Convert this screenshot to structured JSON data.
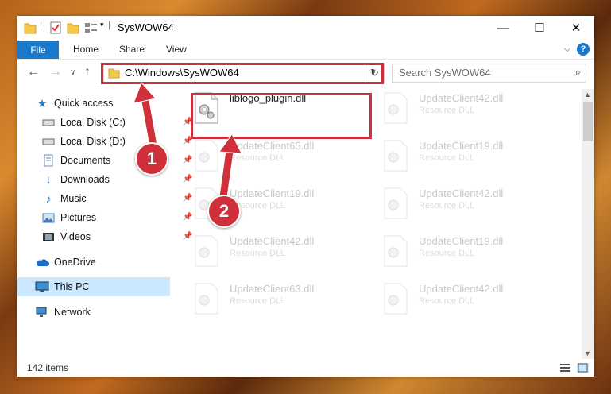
{
  "window": {
    "title": "SysWOW64"
  },
  "ribbon": {
    "file": "File",
    "tabs": [
      "Home",
      "Share",
      "View"
    ],
    "help": "?"
  },
  "address": {
    "path": "C:\\Windows\\SysWOW64"
  },
  "search": {
    "placeholder": "Search SysWOW64"
  },
  "nav": {
    "quick_access": "Quick access",
    "items": [
      {
        "label": "Local Disk (C:)",
        "icon": "drive-icon"
      },
      {
        "label": "Local Disk (D:)",
        "icon": "drive-icon"
      },
      {
        "label": "Documents",
        "icon": "documents-icon"
      },
      {
        "label": "Downloads",
        "icon": "downloads-icon"
      },
      {
        "label": "Music",
        "icon": "music-icon"
      },
      {
        "label": "Pictures",
        "icon": "pictures-icon"
      },
      {
        "label": "Videos",
        "icon": "videos-icon"
      }
    ],
    "onedrive": "OneDrive",
    "this_pc": "This PC",
    "network": "Network"
  },
  "files": [
    {
      "name": "liblogo_plugin.dll",
      "type": ""
    },
    {
      "name": "UpdateClient42.dll",
      "type": "Resource DLL"
    },
    {
      "name": "UpdateClient65.dll",
      "type": "Resource DLL"
    },
    {
      "name": "UpdateClient19.dll",
      "type": "Resource DLL"
    },
    {
      "name": "UpdateClient19.dll",
      "type": "Resource DLL"
    },
    {
      "name": "UpdateClient42.dll",
      "type": "Resource DLL"
    },
    {
      "name": "UpdateClient42.dll",
      "type": "Resource DLL"
    },
    {
      "name": "UpdateClient19.dll",
      "type": "Resource DLL"
    },
    {
      "name": "UpdateClient63.dll",
      "type": "Resource DLL"
    },
    {
      "name": "UpdateClient42.dll",
      "type": "Resource DLL"
    }
  ],
  "status": {
    "count": "142 items"
  },
  "annotations": {
    "step1": "1",
    "step2": "2",
    "color": "#c8323c"
  }
}
